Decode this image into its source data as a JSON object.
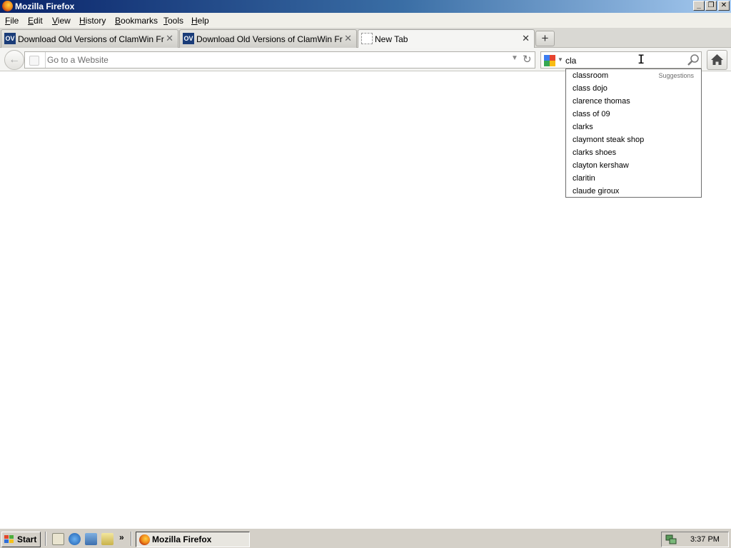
{
  "window": {
    "title": "Mozilla Firefox",
    "controls": {
      "minimize": "_",
      "maximize": "❐",
      "close": "✕"
    }
  },
  "menu": {
    "items": [
      {
        "label": "File",
        "accel": "F",
        "rest": "ile"
      },
      {
        "label": "Edit",
        "accel": "E",
        "rest": "dit"
      },
      {
        "label": "View",
        "accel": "V",
        "rest": "iew"
      },
      {
        "label": "History",
        "accel": "H",
        "rest": "istory"
      },
      {
        "label": "Bookmarks",
        "accel": "B",
        "rest": "ookmarks"
      },
      {
        "label": "Tools",
        "accel": "T",
        "rest": "ools"
      },
      {
        "label": "Help",
        "accel": "H",
        "rest": "elp"
      }
    ]
  },
  "tabs": [
    {
      "label": "Download Old Versions of ClamWin Free ...",
      "favicon_text": "OV",
      "active": false
    },
    {
      "label": "Download Old Versions of ClamWin Free ...",
      "favicon_text": "OV",
      "active": false
    },
    {
      "label": "New Tab",
      "favicon_text": "",
      "active": true
    }
  ],
  "new_tab_label": "+",
  "navbar": {
    "url_placeholder": "Go to a Website",
    "url_value": "",
    "search_value": "cla",
    "search_engine_icon": "google-icon"
  },
  "suggestions": {
    "header": "Suggestions",
    "items": [
      "classroom",
      "class dojo",
      "clarence thomas",
      "class of 09",
      "clarks",
      "claymont steak shop",
      "clarks shoes",
      "clayton kershaw",
      "claritin",
      "claude giroux"
    ]
  },
  "taskbar": {
    "start_label": "Start",
    "more_label": "»",
    "task_label": "Mozilla Firefox",
    "clock": "3:37 PM"
  },
  "colors": {
    "titlebar_start": "#0a246a",
    "titlebar_end": "#a6caf0",
    "taskbar": "#d4d0c8"
  }
}
